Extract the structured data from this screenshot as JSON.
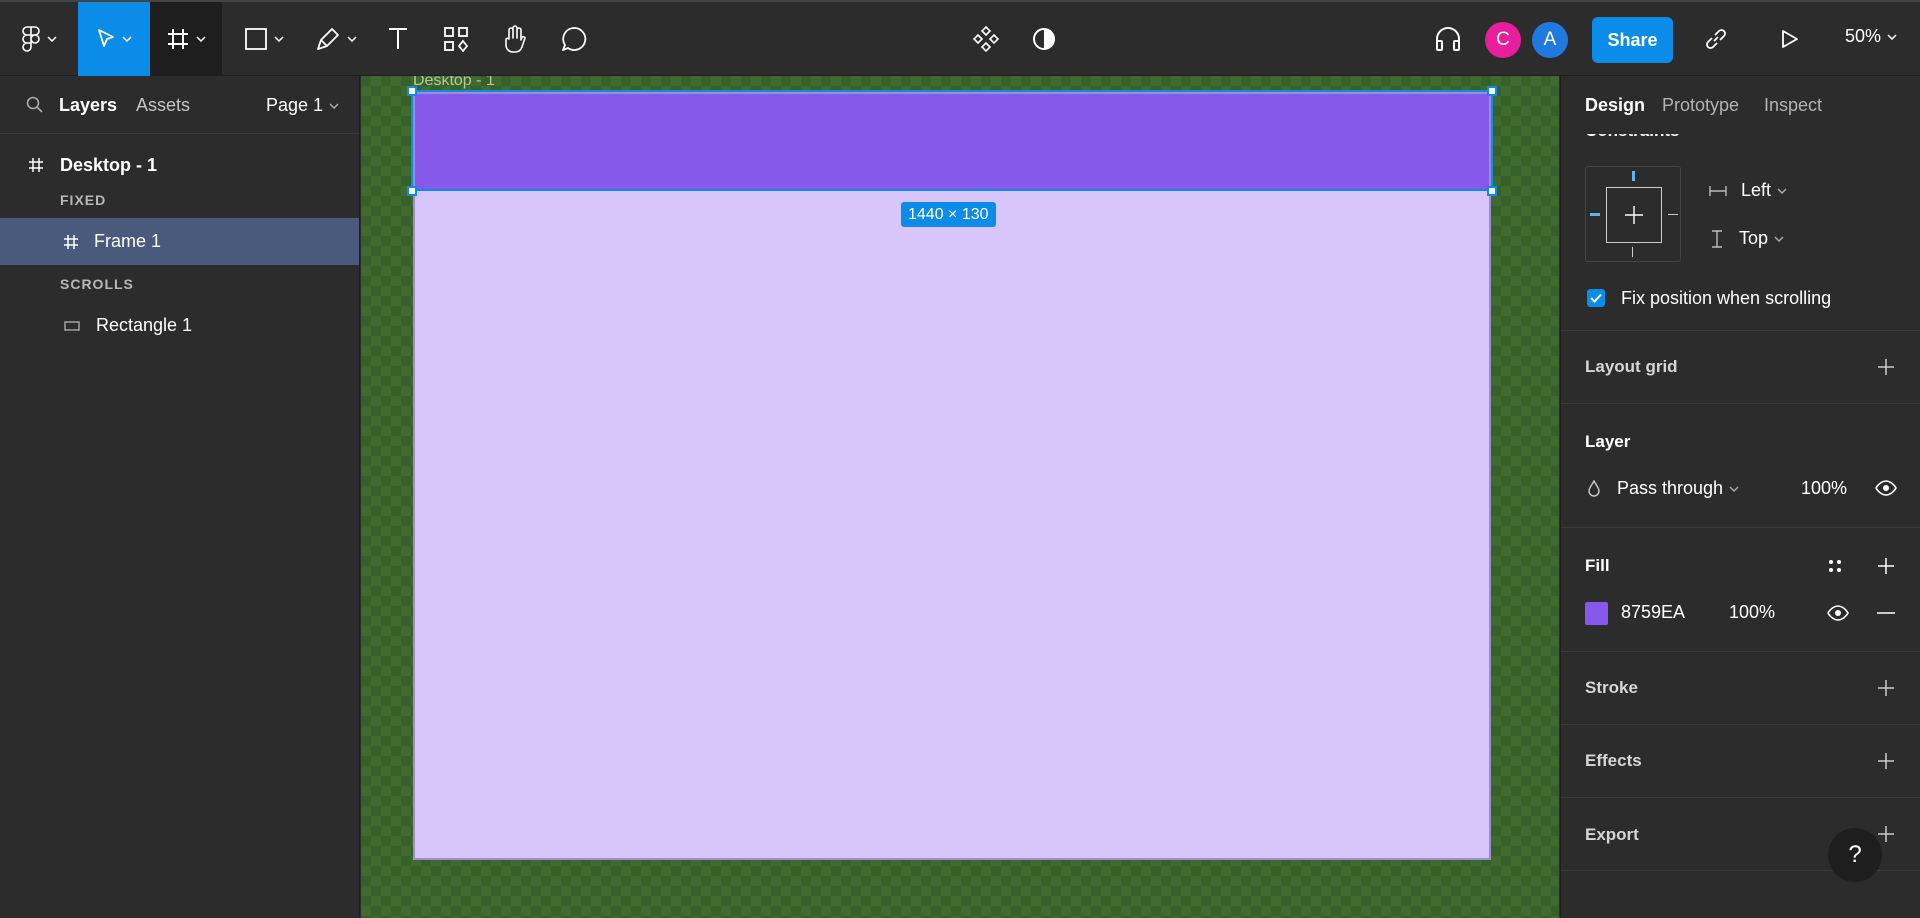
{
  "toolbar": {
    "avatars": [
      {
        "initial": "C",
        "color": "#e91e9c"
      },
      {
        "initial": "A",
        "color": "#1f7ae0"
      }
    ],
    "share_label": "Share",
    "zoom_label": "50%"
  },
  "left_panel": {
    "tabs": {
      "layers": "Layers",
      "assets": "Assets"
    },
    "page_label": "Page 1",
    "layers": {
      "root": "Desktop - 1",
      "fixed_label": "FIXED",
      "frame": "Frame 1",
      "scrolls_label": "SCROLLS",
      "rect": "Rectangle 1"
    }
  },
  "canvas": {
    "frame_name": "Desktop - 1",
    "dimensions": "1440 × 130",
    "frame_fill": "#d8c5f9",
    "header_fill": "#8759ea"
  },
  "right_panel": {
    "tabs": {
      "design": "Design",
      "prototype": "Prototype",
      "inspect": "Inspect"
    },
    "constraints": {
      "title": "Constraints",
      "horizontal": "Left",
      "vertical": "Top",
      "fix_position_label": "Fix position when scrolling",
      "fix_position_checked": true
    },
    "layout_grid": {
      "title": "Layout grid"
    },
    "layer": {
      "title": "Layer",
      "blend": "Pass through",
      "opacity": "100%"
    },
    "fill": {
      "title": "Fill",
      "hex": "8759EA",
      "opacity": "100%",
      "color": "#8759ea"
    },
    "stroke": {
      "title": "Stroke"
    },
    "effects": {
      "title": "Effects"
    },
    "export": {
      "title": "Export"
    }
  },
  "help": {
    "label": "?"
  }
}
